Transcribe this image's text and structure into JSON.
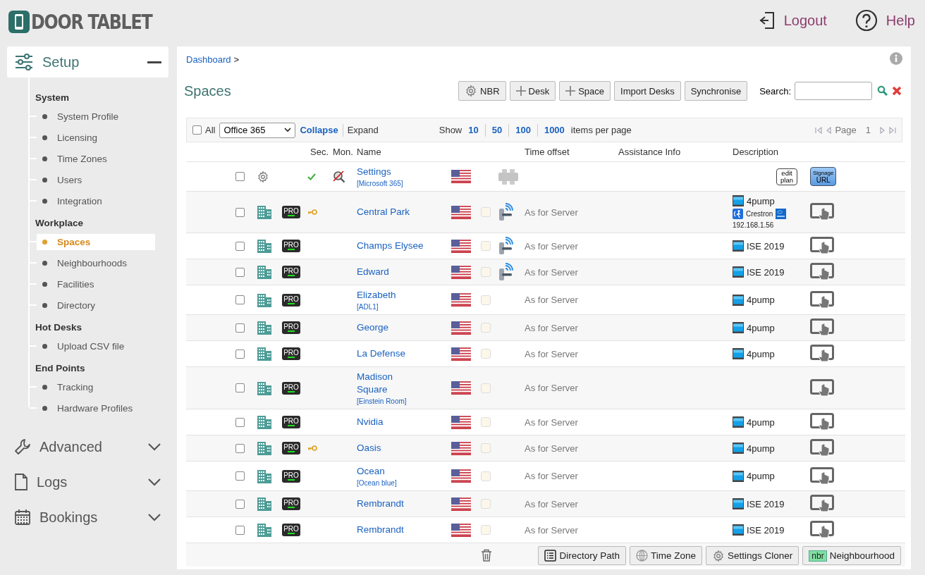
{
  "header": {
    "logo": "DOOR TABLET",
    "logout": "Logout",
    "help": "Help"
  },
  "sidebar": {
    "sections": [
      {
        "label": "Setup",
        "expanded": true,
        "groups": [
          {
            "heading": "System",
            "items": [
              {
                "label": "System Profile",
                "selected": false
              },
              {
                "label": "Licensing",
                "selected": false
              },
              {
                "label": "Time Zones",
                "selected": false
              },
              {
                "label": "Users",
                "selected": false
              },
              {
                "label": "Integration",
                "selected": false
              }
            ]
          },
          {
            "heading": "Workplace",
            "items": [
              {
                "label": "Spaces",
                "selected": true
              },
              {
                "label": "Neighbourhoods",
                "selected": false
              },
              {
                "label": "Facilities",
                "selected": false
              },
              {
                "label": "Directory",
                "selected": false
              }
            ]
          },
          {
            "heading": "Hot Desks",
            "items": [
              {
                "label": "Upload CSV file",
                "selected": false
              }
            ]
          },
          {
            "heading": "End Points",
            "items": [
              {
                "label": "Tracking",
                "selected": false
              },
              {
                "label": "Hardware Profiles",
                "selected": false
              }
            ]
          }
        ]
      },
      {
        "label": "Advanced",
        "expanded": false
      },
      {
        "label": "Logs",
        "expanded": false
      },
      {
        "label": "Bookings",
        "expanded": false
      }
    ]
  },
  "breadcrumb": {
    "link": "Dashboard",
    "separator": ">"
  },
  "title": "Spaces",
  "toolbar": {
    "buttons": [
      {
        "label": "NBR",
        "kind": "gear"
      },
      {
        "label": "Desk",
        "kind": "add"
      },
      {
        "label": "Space",
        "kind": "add"
      },
      {
        "label": "Import Desks",
        "kind": "plain"
      },
      {
        "label": "Synchronise",
        "kind": "plain"
      }
    ],
    "search": {
      "label": "Search:"
    }
  },
  "filter": {
    "all": {
      "label": "All",
      "checked": false
    },
    "source": "Office 365",
    "collapse": "Collapse",
    "expand": "Expand",
    "show": "Show",
    "page_sizes": [
      "10",
      "50",
      "100",
      "1000"
    ],
    "per_page": "items per page",
    "page_label": "Page",
    "page": "1"
  },
  "table": {
    "columns": [
      "Sec.",
      "Mon.",
      "Name",
      "Time offset",
      "Assistance Info",
      "Description"
    ],
    "settings_row": {
      "name": "Settings",
      "subtitle": "[Microsoft 365]",
      "selected": false,
      "enabled": true,
      "monitored": false,
      "edit_plan": [
        "edit",
        "plan"
      ],
      "signage": [
        "Signage",
        "URL"
      ]
    },
    "rows": [
      {
        "name": "Central Park",
        "badge": "PRO",
        "secured": true,
        "door_lock": true,
        "selected": false,
        "checked": false,
        "time_offset": "As for Server",
        "description": [
          {
            "kind": "media",
            "text": "4pump"
          },
          {
            "kind": "crestron",
            "text": "Crestron"
          },
          {
            "kind": "ip",
            "text": "192.168.1.56"
          }
        ]
      },
      {
        "name": "Champs Elysee",
        "badge": "PRO",
        "secured": false,
        "door_lock": true,
        "selected": false,
        "checked": false,
        "time_offset": "As for Server",
        "description": [
          {
            "kind": "media",
            "text": "ISE 2019"
          }
        ]
      },
      {
        "name": "Edward",
        "badge": "PRO",
        "secured": false,
        "door_lock": true,
        "selected": false,
        "checked": false,
        "time_offset": "As for Server",
        "description": [
          {
            "kind": "media",
            "text": "ISE 2019"
          }
        ]
      },
      {
        "name": "Elizabeth",
        "subtitle": "[ADL1]",
        "badge": "PRO",
        "secured": false,
        "door_lock": false,
        "selected": false,
        "checked": false,
        "time_offset": "As for Server",
        "description": [
          {
            "kind": "media",
            "text": "4pump"
          }
        ]
      },
      {
        "name": "George",
        "badge": "PRO",
        "secured": false,
        "door_lock": false,
        "selected": false,
        "checked": false,
        "time_offset": "As for Server",
        "description": [
          {
            "kind": "media",
            "text": "4pump"
          }
        ]
      },
      {
        "name": "La Defense",
        "badge": "PRO",
        "secured": false,
        "door_lock": false,
        "selected": false,
        "checked": false,
        "time_offset": "As for Server",
        "description": [
          {
            "kind": "media",
            "text": "4pump"
          }
        ]
      },
      {
        "name": "Madison Square",
        "subtitle": "[Einstein Room]",
        "badge": "PRO",
        "secured": false,
        "door_lock": false,
        "selected": false,
        "checked": false,
        "time_offset": "As for Server"
      },
      {
        "name": "Nvidia",
        "badge": "PRO",
        "secured": false,
        "door_lock": false,
        "selected": false,
        "checked": false,
        "time_offset": "As for Server",
        "description": [
          {
            "kind": "media",
            "text": "4pump"
          }
        ]
      },
      {
        "name": "Oasis",
        "badge": "PRO",
        "secured": true,
        "door_lock": false,
        "selected": false,
        "checked": false,
        "time_offset": "As for Server",
        "description": [
          {
            "kind": "media",
            "text": "4pump"
          }
        ]
      },
      {
        "name": "Ocean",
        "subtitle": "[Ocean blue]",
        "badge": "PRO",
        "secured": false,
        "door_lock": false,
        "selected": false,
        "checked": false,
        "time_offset": "As for Server",
        "description": [
          {
            "kind": "media",
            "text": "4pump"
          }
        ]
      },
      {
        "name": "Rembrandt",
        "badge": "PRO",
        "secured": false,
        "door_lock": false,
        "selected": false,
        "checked": false,
        "time_offset": "As for Server",
        "description": [
          {
            "kind": "media",
            "text": "ISE 2019"
          }
        ]
      },
      {
        "name": "Rembrandt",
        "badge": "PRO",
        "secured": false,
        "door_lock": false,
        "selected": false,
        "checked": false,
        "time_offset": "As for Server",
        "description": [
          {
            "kind": "media",
            "text": "ISE 2019"
          }
        ]
      }
    ]
  },
  "bottom_bar": [
    {
      "label": "Directory Path",
      "kind": "list"
    },
    {
      "label": "Time Zone",
      "kind": "globe"
    },
    {
      "label": "Settings Cloner",
      "kind": "gear"
    },
    {
      "label": "Neighbourhood",
      "kind": "nbr",
      "badge": "nbr"
    }
  ]
}
